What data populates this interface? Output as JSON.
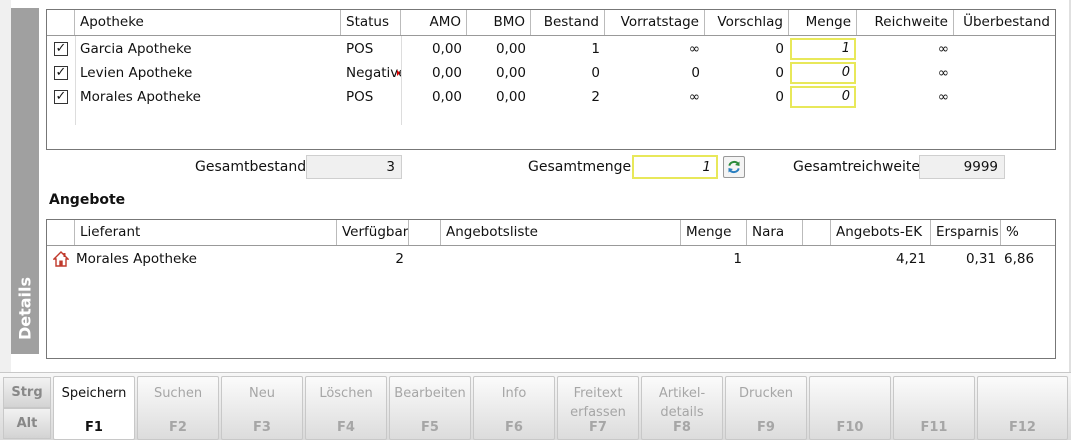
{
  "side_tab": {
    "label": "Details"
  },
  "pharmacy_grid": {
    "columns": [
      "Apotheke",
      "Status",
      "AMO",
      "BMO",
      "Bestand",
      "Vorratstage",
      "Vorschlag",
      "Menge",
      "Reichweite",
      "Überbestand"
    ],
    "rows": [
      {
        "checked": true,
        "apotheke": "Garcia Apotheke",
        "status": "POS",
        "amo": "0,00",
        "bmo": "0,00",
        "bestand": "1",
        "vorratstage": "∞",
        "vorschlag": "0",
        "menge": "1",
        "reichweite": "∞",
        "ueberbestand": ""
      },
      {
        "checked": true,
        "apotheke": "Levien Apotheke",
        "status": "Negative",
        "amo": "0,00",
        "bmo": "0,00",
        "bestand": "0",
        "vorratstage": "0",
        "vorschlag": "0",
        "menge": "0",
        "reichweite": "∞",
        "ueberbestand": ""
      },
      {
        "checked": true,
        "apotheke": "Morales Apotheke",
        "status": "POS",
        "amo": "0,00",
        "bmo": "0,00",
        "bestand": "2",
        "vorratstage": "∞",
        "vorschlag": "0",
        "menge": "0",
        "reichweite": "∞",
        "ueberbestand": ""
      }
    ]
  },
  "summary": {
    "gesamtbestand_label": "Gesamtbestand",
    "gesamtbestand_value": "3",
    "gesamtmenge_label": "Gesamtmenge",
    "gesamtmenge_value": "1",
    "gesamtreichweite_label": "Gesamtreichweite",
    "gesamtreichweite_value": "9999"
  },
  "offers": {
    "title": "Angebote",
    "columns": [
      "Lieferant",
      "Verfügbar",
      "",
      "Angebotsliste",
      "Menge",
      "Nara",
      "",
      "Angebots-EK",
      "Ersparnis",
      "%"
    ],
    "rows": [
      {
        "icon": "home-icon",
        "lieferant": "Morales Apotheke",
        "verfuegbar": "2",
        "angebotsliste": "",
        "menge": "1",
        "nara": "",
        "angebots_ek": "4,21",
        "ersparnis": "0,31",
        "prozent": "6,86"
      }
    ]
  },
  "modifiers": {
    "strg": "Strg",
    "alt": "Alt"
  },
  "fkeys": [
    {
      "label": "Speichern",
      "key": "F1",
      "enabled": true
    },
    {
      "label": "Suchen",
      "key": "F2",
      "enabled": false
    },
    {
      "label": "Neu",
      "key": "F3",
      "enabled": false
    },
    {
      "label": "Löschen",
      "key": "F4",
      "enabled": false
    },
    {
      "label": "Bearbeiten",
      "key": "F5",
      "enabled": false
    },
    {
      "label": "Info",
      "key": "F6",
      "enabled": false
    },
    {
      "label": "Freitext\nerfassen",
      "key": "F7",
      "enabled": false
    },
    {
      "label": "Artikel-\ndetails",
      "key": "F8",
      "enabled": false
    },
    {
      "label": "Drucken",
      "key": "F9",
      "enabled": false
    },
    {
      "label": "",
      "key": "F10",
      "enabled": false
    },
    {
      "label": "",
      "key": "F11",
      "enabled": false
    },
    {
      "label": "",
      "key": "F12",
      "enabled": false
    }
  ]
}
